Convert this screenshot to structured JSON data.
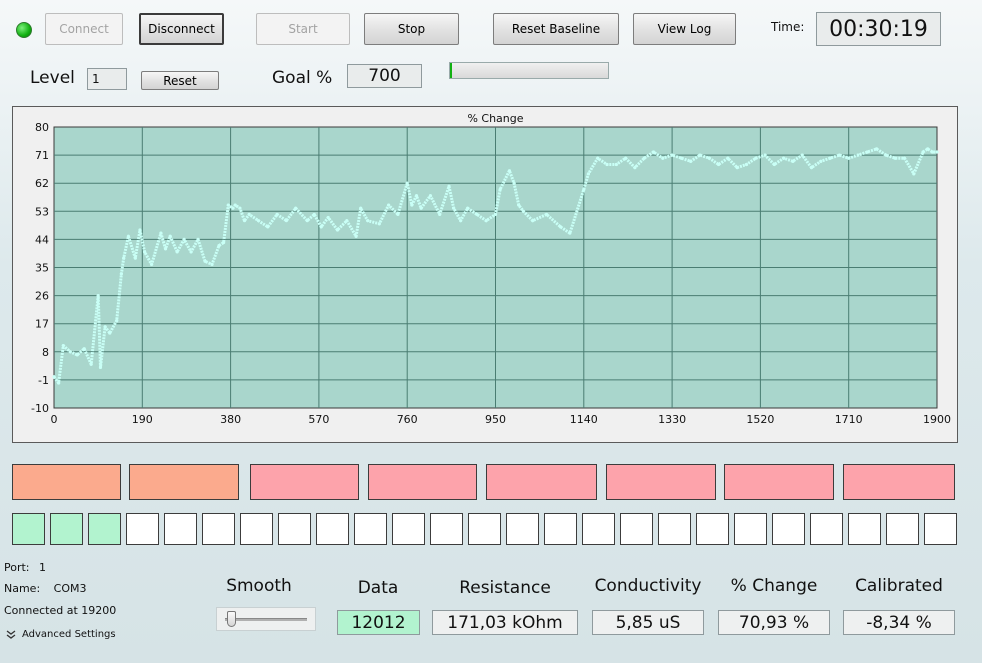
{
  "toolbar": {
    "connect_label": "Connect",
    "disconnect_label": "Disconnect",
    "start_label": "Start",
    "stop_label": "Stop",
    "reset_baseline_label": "Reset Baseline",
    "view_log_label": "View Log",
    "time_label": "Time:",
    "time_value": "00:30:19"
  },
  "level": {
    "label": "Level",
    "value": "1",
    "reset_label": "Reset"
  },
  "goal": {
    "label": "Goal %",
    "value": "700",
    "progress": 0.01
  },
  "colors": {
    "plot_bg": "#a9d6cc",
    "line": "#c9fff6",
    "segment_orange": "#fbaa8d",
    "segment_pink": "#fda3ab",
    "square_on": "#b2f3cf",
    "led_green": "#11b011"
  },
  "chart_data": {
    "type": "line",
    "title": "% Change",
    "xlabel": "",
    "ylabel": "",
    "xlim": [
      0,
      1900
    ],
    "ylim": [
      -10,
      80
    ],
    "x_ticks": [
      "0",
      "190",
      "380",
      "570",
      "760",
      "950",
      "1140",
      "1330",
      "1520",
      "1710",
      "1900"
    ],
    "y_ticks": [
      "80",
      "71",
      "62",
      "53",
      "44",
      "35",
      "26",
      "17",
      "8",
      "-1",
      "-10"
    ],
    "grid": true,
    "series": [
      {
        "x": [
          0,
          10,
          20,
          35,
          50,
          65,
          80,
          95,
          100,
          110,
          120,
          135,
          145,
          150,
          160,
          175,
          185,
          195,
          210,
          230,
          240,
          250,
          265,
          280,
          295,
          310,
          325,
          340,
          355,
          365,
          375,
          385,
          390,
          400,
          410,
          420,
          440,
          460,
          480,
          500,
          520,
          545,
          560,
          575,
          590,
          610,
          630,
          650,
          660,
          675,
          700,
          720,
          740,
          760,
          770,
          780,
          790,
          810,
          830,
          850,
          860,
          875,
          890,
          910,
          930,
          950,
          960,
          980,
          990,
          1000,
          1010,
          1030,
          1060,
          1090,
          1110,
          1140,
          1150,
          1170,
          1190,
          1210,
          1230,
          1250,
          1270,
          1290,
          1310,
          1330,
          1350,
          1370,
          1390,
          1410,
          1430,
          1450,
          1470,
          1490,
          1510,
          1530,
          1550,
          1570,
          1590,
          1610,
          1630,
          1650,
          1670,
          1690,
          1710,
          1730,
          1750,
          1770,
          1790,
          1810,
          1830,
          1850,
          1870,
          1880,
          1890,
          1900
        ],
        "y": [
          0,
          -2,
          10,
          8,
          7,
          9,
          4,
          26,
          3,
          16,
          14,
          18,
          33,
          38,
          45,
          38,
          47,
          40,
          36,
          46,
          41,
          45,
          40,
          44,
          40,
          44,
          37,
          36,
          42,
          43,
          55,
          54,
          55,
          54,
          50,
          52,
          50,
          48,
          52,
          50,
          54,
          50,
          52,
          48,
          51,
          47,
          50,
          45,
          54,
          50,
          49,
          55,
          52,
          62,
          55,
          58,
          54,
          58,
          52,
          61,
          54,
          50,
          54,
          52,
          50,
          52,
          60,
          66,
          62,
          55,
          53,
          50,
          52,
          48,
          46,
          60,
          65,
          70,
          68,
          68,
          70,
          67,
          70,
          72,
          70,
          71,
          70,
          69,
          71,
          70,
          68,
          70,
          67,
          68,
          70,
          71,
          68,
          70,
          69,
          71,
          67,
          69,
          70,
          71,
          70,
          71,
          72,
          73,
          71,
          70,
          70,
          65,
          72,
          73,
          72,
          72
        ]
      }
    ]
  },
  "segments": [
    "orange",
    "orange",
    "pink",
    "pink",
    "pink",
    "pink",
    "pink",
    "pink"
  ],
  "squares": [
    true,
    true,
    true,
    false,
    false,
    false,
    false,
    false,
    false,
    false,
    false,
    false,
    false,
    false,
    false,
    false,
    false,
    false,
    false,
    false,
    false,
    false,
    false,
    false,
    false
  ],
  "port": {
    "port_label": "Port:",
    "port_value": "1",
    "name_label": "Name:",
    "name_value": "COM3",
    "connected_text": "Connected at 19200",
    "advanced_label": "Advanced Settings"
  },
  "readouts": {
    "smooth_label": "Smooth",
    "smooth_value": 0.03,
    "data_label": "Data",
    "data_value": "12012",
    "resistance_label": "Resistance",
    "resistance_value": "171,03 kOhm",
    "conductivity_label": "Conductivity",
    "conductivity_value": "5,85 uS",
    "change_label": "% Change",
    "change_value": "70,93 %",
    "calibrated_label": "Calibrated",
    "calibrated_value": "-8,34 %"
  },
  "icons": {
    "status": "status-led",
    "advanced": "double-chevron-down-icon"
  }
}
